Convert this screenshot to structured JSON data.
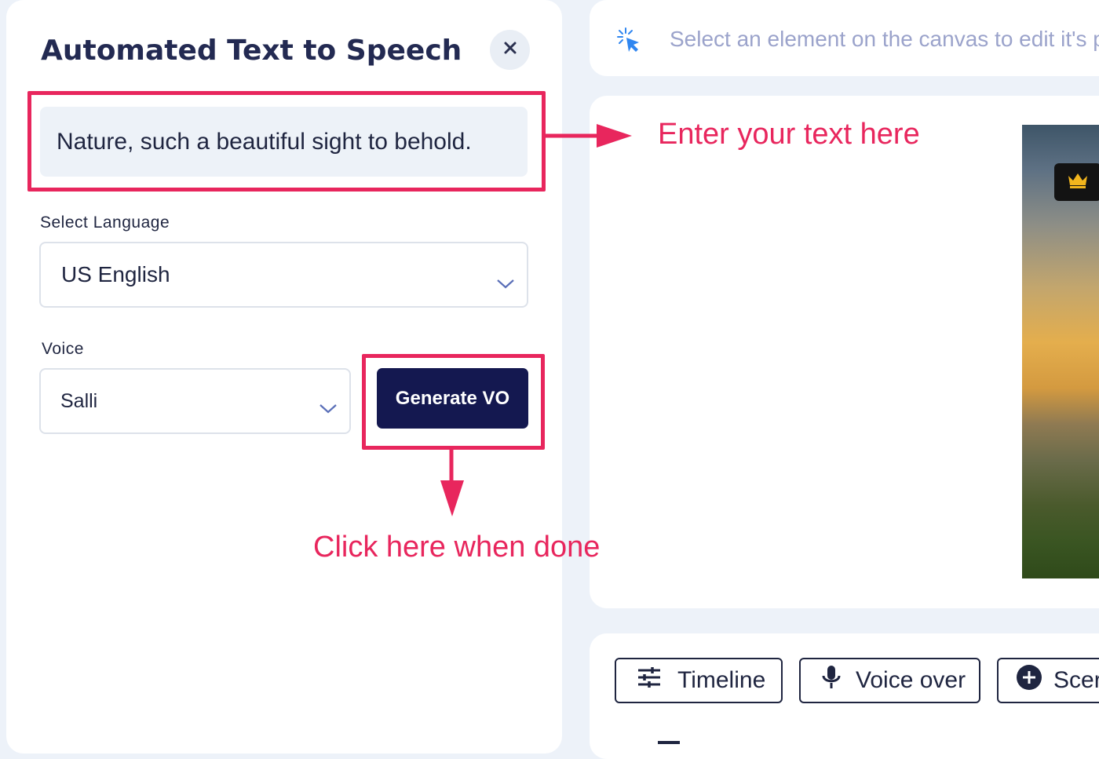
{
  "panel": {
    "title": "Automated Text to Speech",
    "close_icon": "close-icon",
    "text_input_value": "Nature, such a beautiful sight to behold.",
    "language": {
      "label": "Select Language",
      "selected": "US English"
    },
    "voice": {
      "label": "Voice",
      "selected": "Salli"
    },
    "generate_label": "Generate VO"
  },
  "annotations": {
    "text_hint": "Enter your text here",
    "button_hint": "Click here when done",
    "color": "#e8265d"
  },
  "toolbar_hint": "Select an element on the canvas to edit it's p",
  "bottom_buttons": [
    {
      "label": "Timeline",
      "icon": "timeline-icon"
    },
    {
      "label": "Voice over",
      "icon": "microphone-icon"
    },
    {
      "label": "Scer",
      "icon": "plus-circle-icon"
    }
  ],
  "colors": {
    "primary_button": "#141850",
    "title_text": "#232a52",
    "hint_text": "#9ba3cb",
    "accent_blue": "#2f86f0"
  }
}
